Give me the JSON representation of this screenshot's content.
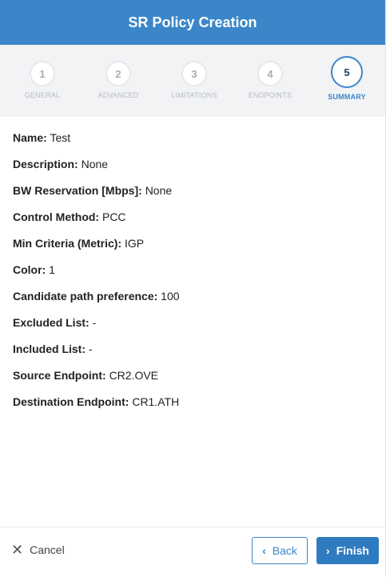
{
  "header": {
    "title": "SR Policy Creation"
  },
  "steps": [
    {
      "number": "1",
      "label": "GENERAL"
    },
    {
      "number": "2",
      "label": "ADVANCED"
    },
    {
      "number": "3",
      "label": "LIMITATIONS"
    },
    {
      "number": "4",
      "label": "ENDPOINTS"
    },
    {
      "number": "5",
      "label": "SUMMARY"
    }
  ],
  "active_step": 5,
  "summary": [
    {
      "key": "Name:",
      "value": "Test"
    },
    {
      "key": "Description:",
      "value": "None"
    },
    {
      "key": "BW Reservation [Mbps]:",
      "value": "None"
    },
    {
      "key": "Control Method:",
      "value": "PCC"
    },
    {
      "key": "Min Criteria (Metric):",
      "value": "IGP"
    },
    {
      "key": "Color:",
      "value": "1"
    },
    {
      "key": "Candidate path preference:",
      "value": "100"
    },
    {
      "key": "Excluded List:",
      "value": "-"
    },
    {
      "key": "Included List:",
      "value": "-"
    },
    {
      "key": "Source Endpoint:",
      "value": "CR2.OVE"
    },
    {
      "key": "Destination Endpoint:",
      "value": "CR1.ATH"
    }
  ],
  "footer": {
    "cancel_label": "Cancel",
    "back_label": "Back",
    "finish_label": "Finish",
    "cancel_icon": "close-icon",
    "back_icon": "chevron-left-icon",
    "finish_icon": "chevron-right-icon"
  },
  "colors": {
    "header": "#3b86c8",
    "accent": "#3b86c8",
    "finish_button": "#2f7bbf"
  }
}
